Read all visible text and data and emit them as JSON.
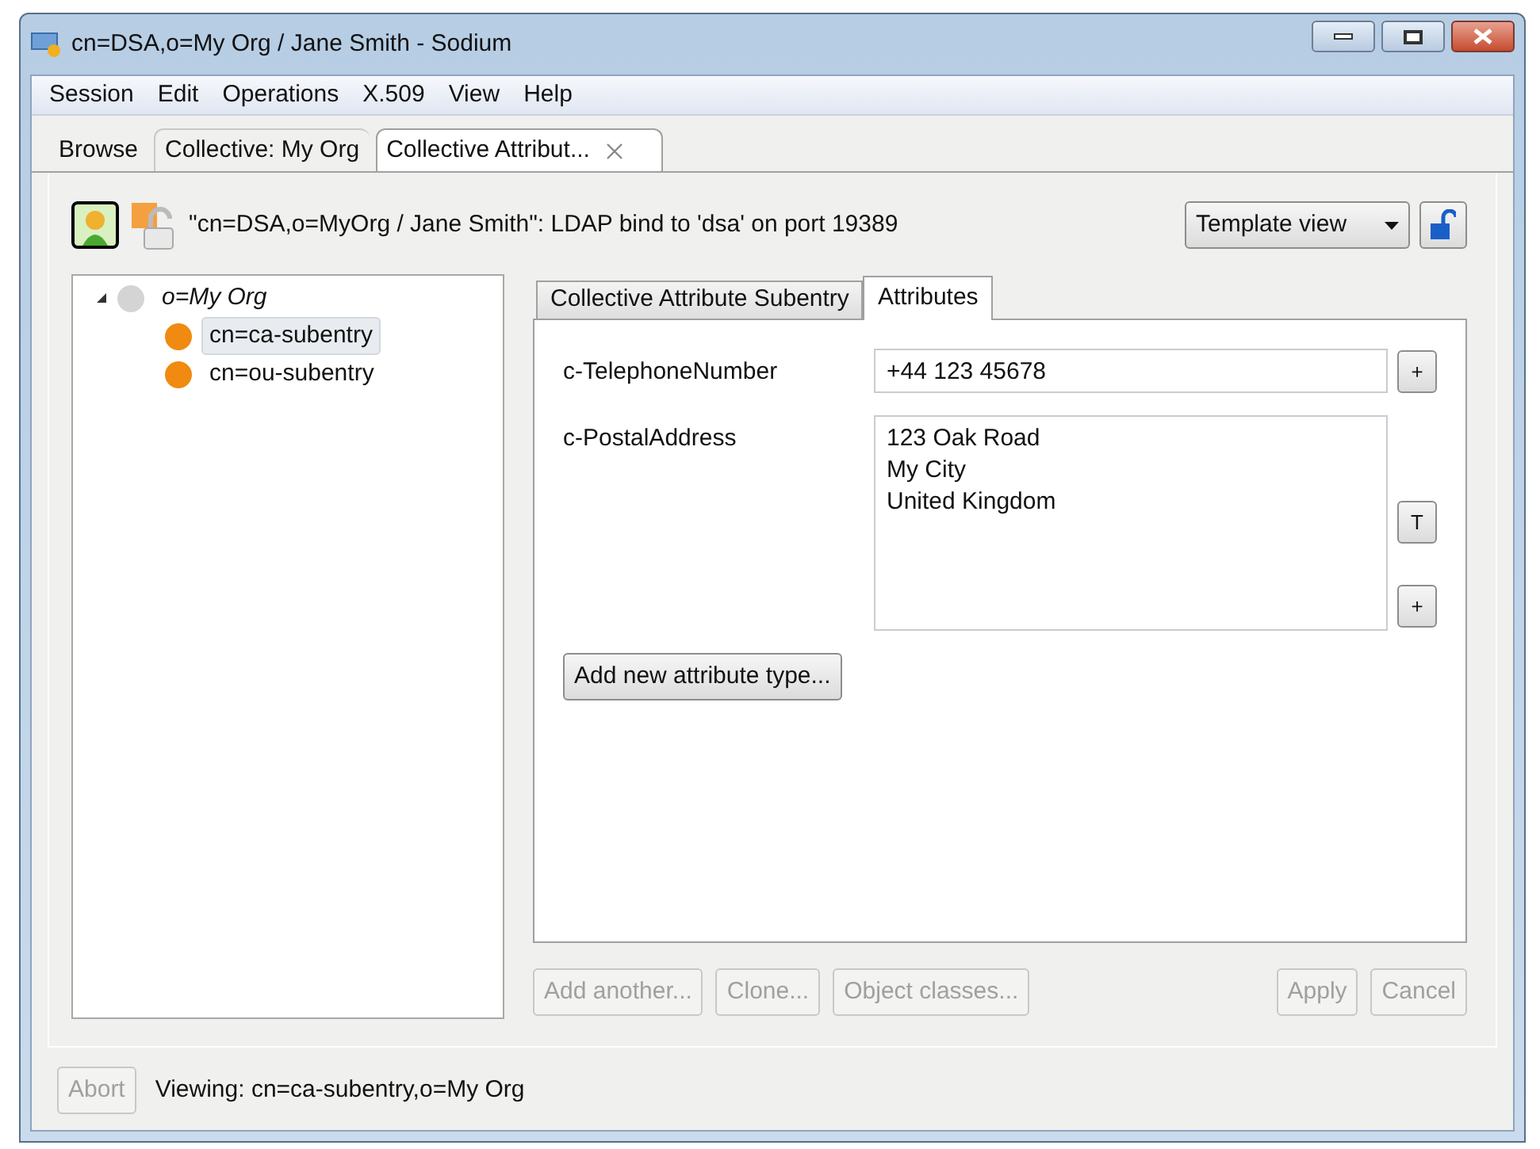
{
  "window": {
    "title": "cn=DSA,o=My Org / Jane Smith - Sodium"
  },
  "menu": [
    "Session",
    "Edit",
    "Operations",
    "X.509",
    "View",
    "Help"
  ],
  "tabs": [
    {
      "label": "Browse",
      "selected": false,
      "closable": false
    },
    {
      "label": "Collective: My Org",
      "selected": false,
      "closable": false
    },
    {
      "label": "Collective Attribut...",
      "selected": true,
      "closable": true
    }
  ],
  "connection": {
    "text": "\"cn=DSA,o=MyOrg / Jane Smith\": LDAP bind to 'dsa' on port 19389",
    "locked": false
  },
  "view_select": {
    "value": "Template view"
  },
  "tree": [
    {
      "label": "o=My Org",
      "expanded": true,
      "selected": false,
      "color": "#d4d4d4",
      "children": [
        {
          "label": "cn=ca-subentry",
          "selected": true,
          "color": "#f08a10"
        },
        {
          "label": "cn=ou-subentry",
          "selected": false,
          "color": "#f08a10"
        }
      ]
    }
  ],
  "editor_tabs": [
    {
      "label": "Collective Attribute Subentry",
      "selected": false
    },
    {
      "label": "Attributes",
      "selected": true
    }
  ],
  "attributes": [
    {
      "name": "c-TelephoneNumber",
      "kind": "line",
      "value": "+44 123 45678",
      "buttons": [
        "+"
      ]
    },
    {
      "name": "c-PostalAddress",
      "kind": "text",
      "lines": [
        "123 Oak Road",
        "My City",
        "United Kingdom"
      ],
      "buttons": [
        "T",
        "+"
      ]
    }
  ],
  "add_attribute_button": "Add new attribute type...",
  "actions_left": [
    {
      "label": "Add another...",
      "disabled": true
    },
    {
      "label": "Clone...",
      "disabled": true
    },
    {
      "label": "Object classes...",
      "disabled": true
    }
  ],
  "actions_right": [
    {
      "label": "Apply",
      "disabled": true
    },
    {
      "label": "Cancel",
      "disabled": true
    }
  ],
  "status": {
    "abort": {
      "label": "Abort",
      "disabled": true
    },
    "text": "Viewing: cn=ca-subentry,o=My Org"
  }
}
